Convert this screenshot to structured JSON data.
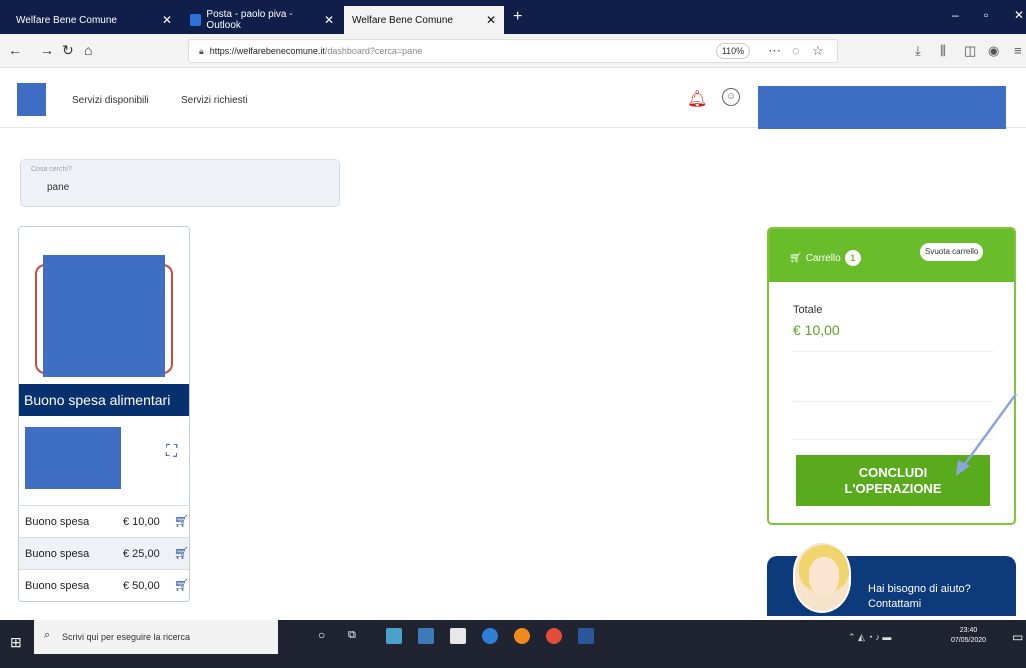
{
  "browser": {
    "tabs": [
      {
        "label": "Welfare Bene Comune",
        "close": "✕"
      },
      {
        "label": "Posta - paolo piva - Outlook",
        "close": "✕"
      },
      {
        "label": "Welfare Bene Comune",
        "close": "✕"
      }
    ],
    "new_tab": "+",
    "url_host": "https://welfarebenecomune.it",
    "url_path": "/dashboard?cerca=pane",
    "zoom": "110%"
  },
  "app": {
    "nav": [
      "Servizi disponibili",
      "Servizi richiesti"
    ]
  },
  "search": {
    "label": "Cosa cerchi?",
    "value": "pane"
  },
  "product": {
    "title": "Buono spesa alimentari",
    "items": [
      {
        "name": "Buono spesa",
        "price": "€ 10,00"
      },
      {
        "name": "Buono spesa",
        "price": "€ 25,00"
      },
      {
        "name": "Buono spesa",
        "price": "€ 50,00"
      }
    ]
  },
  "cart": {
    "title": "Carrello",
    "count": "1",
    "empty_label": "Svuota carrello",
    "total_label": "Totale",
    "total_value": "€ 10,00",
    "checkout_label_1": "CONCLUDI",
    "checkout_label_2": "L'OPERAZIONE"
  },
  "help": {
    "line1": "Hai bisogno di aiuto?",
    "line2": "Contattami"
  },
  "taskbar": {
    "search_placeholder": "Scrivi qui per eseguire la ricerca",
    "time": "23:40",
    "date": "07/05/2020"
  },
  "colors": {
    "accent_green": "#69bd2a",
    "navy": "#06316e",
    "redaction_blue": "#3f6fc5"
  }
}
